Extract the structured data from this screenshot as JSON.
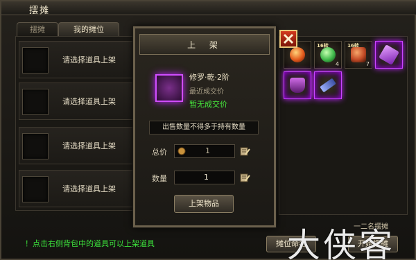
{
  "window": {
    "title": "摆摊"
  },
  "tabs": [
    {
      "label": "摆摊"
    },
    {
      "label": "我的摊位"
    }
  ],
  "slots": [
    {
      "label": "请选择道具上架"
    },
    {
      "label": "请选择道具上架"
    },
    {
      "label": "请选择道具上架"
    },
    {
      "label": "请选择道具上架"
    }
  ],
  "bag": {
    "items": [
      {
        "icon": "fire-orb-icon",
        "level": "",
        "count": "",
        "color": "#e25a1c"
      },
      {
        "icon": "green-orb-icon",
        "level": "16转",
        "count": "4",
        "color": "#3fb84a"
      },
      {
        "icon": "ore-icon",
        "level": "16转",
        "count": "7",
        "color": "#c24a26"
      },
      {
        "icon": "purple-gem-icon",
        "level": "",
        "count": "",
        "color": "#9d3bd0"
      },
      {
        "icon": "purple-helmet-icon",
        "level": "",
        "count": "",
        "color": "#a633c8"
      },
      {
        "icon": "blue-weapon-icon",
        "level": "",
        "count": "",
        "color": "#4a62b5"
      }
    ]
  },
  "dialog": {
    "title": "上 架",
    "item_name": "修罗·乾·2阶",
    "last_price_label": "最近成交价",
    "no_trade": "暂无成交价",
    "notice": "出售数量不得多于持有数量",
    "total_label": "总价",
    "total_value": "1",
    "qty_label": "数量",
    "qty_value": "1",
    "submit_label": "上架物品"
  },
  "footer": {
    "tip": "！点击右侧背包中的道具可以上架道具",
    "rename_button": "摊位命名",
    "start_button": "开始摆摊",
    "seller_name": "一二名摆摊"
  },
  "watermark": "大侠客",
  "colors": {
    "accent_green": "#3ce33c",
    "rare_purple": "#c026ff",
    "close_red": "#d33a1e"
  }
}
